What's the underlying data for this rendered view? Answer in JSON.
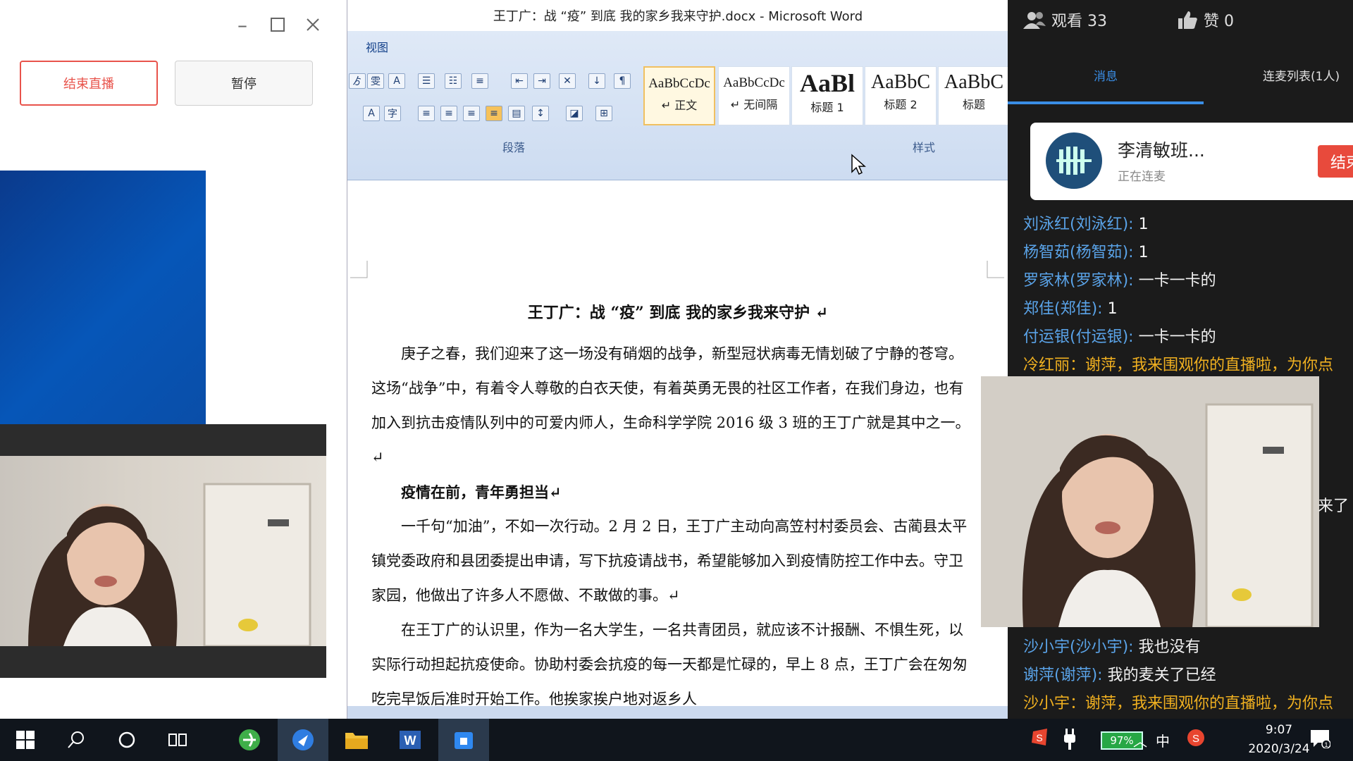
{
  "left_panel": {
    "end_live_label": "结束直播",
    "pause_label": "暂停"
  },
  "word": {
    "window_title": "王丁广：战 “疫” 到底 我的家乡我来守护.docx - Microsoft Word",
    "tab_view": "视图",
    "group_paragraph": "段落",
    "group_styles": "样式",
    "styles": [
      {
        "sample": "AaBbCcDc",
        "name": "↵ 正文"
      },
      {
        "sample": "AaBbCcDc",
        "name": "↵ 无间隔"
      },
      {
        "sample": "AaBl",
        "name": "标题 1"
      },
      {
        "sample": "AaBbC",
        "name": "标题 2"
      },
      {
        "sample": "AaBbC",
        "name": "标题"
      }
    ],
    "doc": {
      "title": "王丁广：战 “疫” 到底 我的家乡我来守护 ↵",
      "p1": "庚子之春，我们迎来了这一场没有硝烟的战争，新型冠状病毒无情划破了宁静的苍穹。这场“战争”中，有着令人尊敬的白衣天使，有着英勇无畏的社区工作者，在我们身边，也有加入到抗击疫情队列中的可爱内师人，生命科学学院 2016 级 3 班的王丁广就是其中之一。 ↵",
      "p2": "疫情在前，青年勇担当↵",
      "p3": "一千句“加油”，不如一次行动。2 月 2 日，王丁广主动向高笠村村委员会、古蔺县太平镇党委政府和县团委提出申请，写下抗疫请战书，希望能够加入到疫情防控工作中去。守卫家园，他做出了许多人不愿做、不敢做的事。↵",
      "p4": "在王丁广的认识里，作为一名大学生，一名共青团员，就应该不计报酬、不惧生死，以实际行动担起抗疫使命。协助村委会抗疫的每一天都是忙碌的，早上 8 点，王丁广会在匆匆吃完早饭后准时开始工作。他挨家挨户地对返乡人"
    }
  },
  "right_panel": {
    "viewers": "观看 33",
    "likes": "赞 0",
    "tab_messages": "消息",
    "tab_mic_list": "连麦列表(1人)",
    "connect_name": "李清敏班...",
    "connect_status": "正在连麦",
    "end_connect_label": "结束",
    "chat_top": [
      {
        "who": "刘泳红(刘泳红):",
        "msg": " 1"
      },
      {
        "who": "杨智茹(杨智茹):",
        "msg": " 1"
      },
      {
        "who": "罗家林(罗家林):",
        "msg": " 一卡一卡的"
      },
      {
        "who": "郑佳(郑佳):",
        "msg": " 1"
      },
      {
        "who": "付运银(付运银):",
        "msg": " 一卡一卡的"
      }
    ],
    "chat_gift_1": "冷红丽：谢萍，我来围观你的直播啦，为你点",
    "cut_text": "来了",
    "chat_bottom": [
      {
        "who": "沙小宇(沙小宇):",
        "msg": " 我也没有"
      },
      {
        "who": "谢萍(谢萍):",
        "msg": " 我的麦关了已经"
      }
    ],
    "chat_gift_2": "沙小宇：谢萍，我来围观你的直播啦，为你点"
  },
  "taskbar": {
    "battery": "97%",
    "ime": "中",
    "time": "9:07",
    "date": "2020/3/24"
  },
  "colors": {
    "accent_blue": "#3a8ee6",
    "danger_red": "#e84a3c",
    "gift_orange": "#f0b020",
    "username_blue": "#5aa3e8"
  }
}
